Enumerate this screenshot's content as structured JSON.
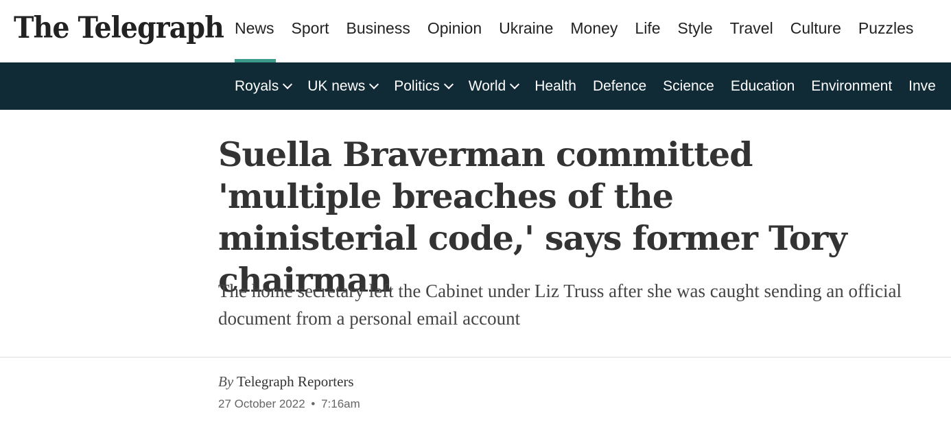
{
  "header": {
    "logo_text": "The Telegraph",
    "primary_nav": [
      {
        "label": "News",
        "active": true
      },
      {
        "label": "Sport"
      },
      {
        "label": "Business"
      },
      {
        "label": "Opinion"
      },
      {
        "label": "Ukraine"
      },
      {
        "label": "Money"
      },
      {
        "label": "Life"
      },
      {
        "label": "Style"
      },
      {
        "label": "Travel"
      },
      {
        "label": "Culture"
      },
      {
        "label": "Puzzles"
      }
    ],
    "accent_color": "#3b9a8a"
  },
  "subnav": {
    "background_color": "#102a36",
    "items": [
      {
        "label": "Royals",
        "has_dropdown": true
      },
      {
        "label": "UK news",
        "has_dropdown": true
      },
      {
        "label": "Politics",
        "has_dropdown": true
      },
      {
        "label": "World",
        "has_dropdown": true
      },
      {
        "label": "Health"
      },
      {
        "label": "Defence"
      },
      {
        "label": "Science"
      },
      {
        "label": "Education"
      },
      {
        "label": "Environment"
      },
      {
        "label": "Inve"
      }
    ]
  },
  "article": {
    "headline": "Suella Braverman committed 'multiple breaches of the ministerial code,' says former Tory chairman",
    "standfirst": "The home secretary left the Cabinet under Liz Truss after she was caught sending an official document from a personal email account",
    "byline_prefix": "By",
    "author": "Telegraph Reporters",
    "date": "27 October 2022",
    "separator": "•",
    "time": "7:16am"
  }
}
